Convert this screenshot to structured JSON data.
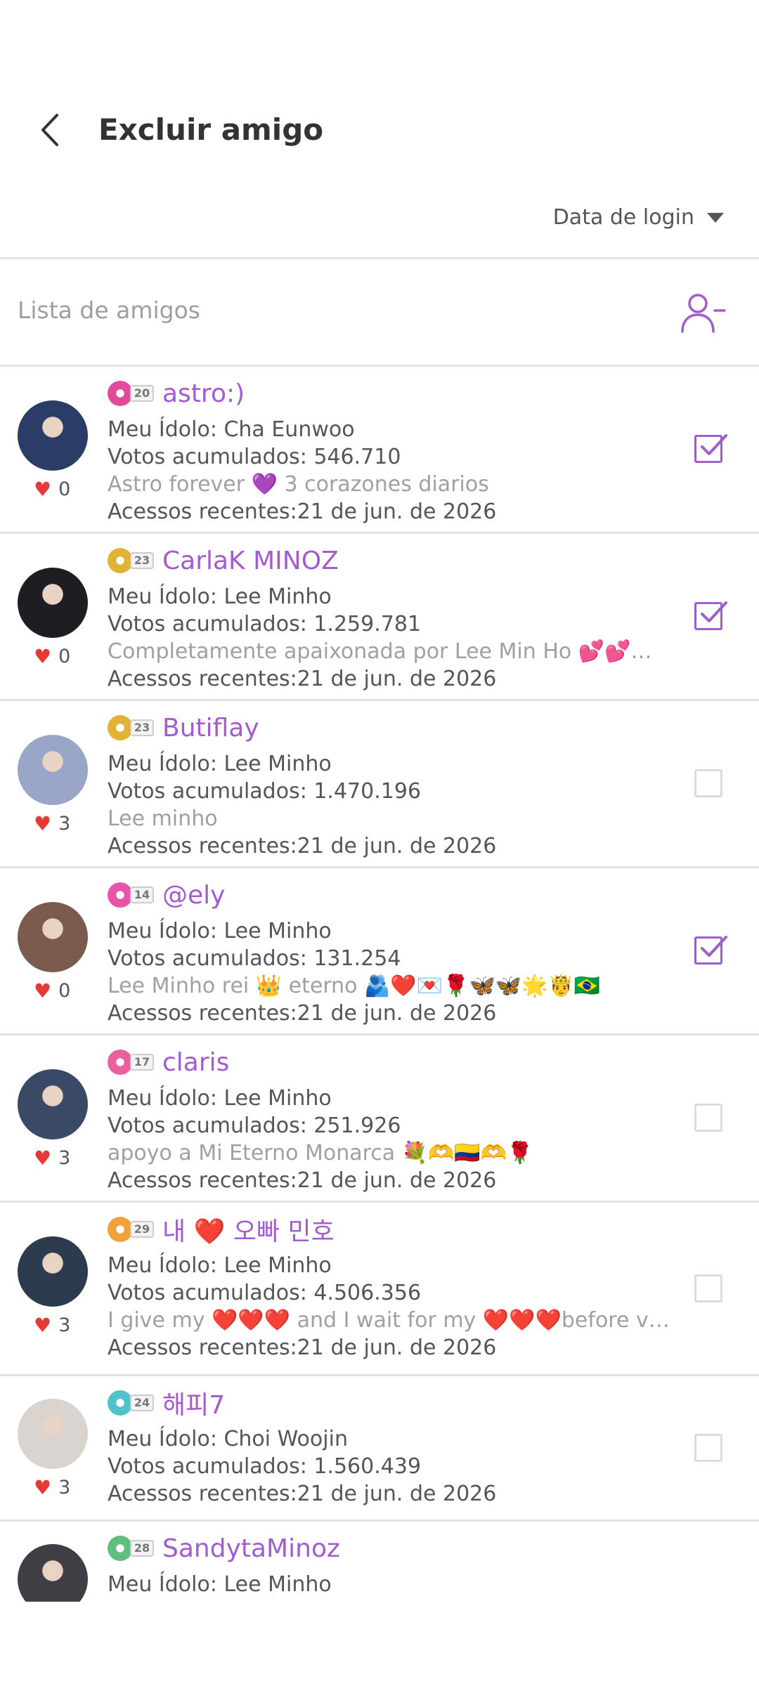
{
  "header": {
    "title": "Excluir amigo"
  },
  "sort": {
    "label": "Data de login"
  },
  "list_header": {
    "label": "Lista de amigos"
  },
  "colors": {
    "accent": "#a45bd0",
    "heart": "#e53935",
    "divider": "#e2e2e2"
  },
  "friends": [
    {
      "name": "astro:)",
      "level": "20",
      "badge_color": "#e04c9a",
      "idol": "Meu Ídolo: Cha Eunwoo",
      "votes": "Votos acumulados: 546.710",
      "message": "Astro forever 💜 3 corazones diarios",
      "recent": "Acessos recentes:21 de jun. de 2026",
      "hearts": "0",
      "checked": true,
      "avatar_color": "#2b3d66"
    },
    {
      "name": "CarlaK MINOZ",
      "level": "23",
      "badge_color": "#e1b233",
      "idol": "Meu Ídolo: Lee Minho",
      "votes": "Votos acumulados: 1.259.781",
      "message": "Completamente apaixonada por Lee Min Ho 💕💕🇧🇷...",
      "recent": "Acessos recentes:21 de jun. de 2026",
      "hearts": "0",
      "checked": true,
      "avatar_color": "#1e1e22"
    },
    {
      "name": "Butiflay",
      "level": "23",
      "badge_color": "#e1b233",
      "idol": "Meu Ídolo: Lee Minho",
      "votes": "Votos acumulados: 1.470.196",
      "message": "Lee minho",
      "recent": "Acessos recentes:21 de jun. de 2026",
      "hearts": "3",
      "checked": false,
      "avatar_color": "#9aa6c8"
    },
    {
      "name": "@ely",
      "level": "14",
      "badge_color": "#e855a8",
      "idol": "Meu Ídolo: Lee Minho",
      "votes": "Votos acumulados: 131.254",
      "message": "Lee Minho rei 👑 eterno 🫂❤️💌🌹🦋🦋🌟🤴🇧🇷",
      "recent": "Acessos recentes:21 de jun. de 2026",
      "hearts": "0",
      "checked": true,
      "avatar_color": "#7a5b4e"
    },
    {
      "name": "claris",
      "level": "17",
      "badge_color": "#e9609c",
      "idol": "Meu Ídolo: Lee Minho",
      "votes": "Votos acumulados: 251.926",
      "message": "apoyo a Mi Eterno Monarca 💐🫶🇨🇴🫶🌹",
      "recent": "Acessos recentes:21 de jun. de 2026",
      "hearts": "3",
      "checked": false,
      "avatar_color": "#3a4a66"
    },
    {
      "name": "내 ❤️ 오빠 민호",
      "level": "29",
      "badge_color": "#f0a23a",
      "idol": "Meu Ídolo: Lee Minho",
      "votes": "Votos acumulados: 4.506.356",
      "message": "I give my ❤️❤️❤️ and I wait for my ❤️❤️❤️before voti...",
      "recent": "Acessos recentes:21 de jun. de 2026",
      "hearts": "3",
      "checked": false,
      "avatar_color": "#2c3b4e"
    },
    {
      "name": "해피7",
      "level": "24",
      "badge_color": "#4fc3c9",
      "idol": "Meu Ídolo: Choi Woojin",
      "votes": "Votos acumulados: 1.560.439",
      "message": "",
      "recent": "Acessos recentes:21 de jun. de 2026",
      "hearts": "3",
      "checked": false,
      "avatar_color": "#d9d4cf"
    },
    {
      "name": "SandytaMinoz",
      "level": "28",
      "badge_color": "#5fbf7f",
      "idol": "Meu Ídolo: Lee Minho",
      "votes": "",
      "message": "",
      "recent": "",
      "hearts": "",
      "checked": false,
      "avatar_color": "#3e3e44"
    }
  ]
}
